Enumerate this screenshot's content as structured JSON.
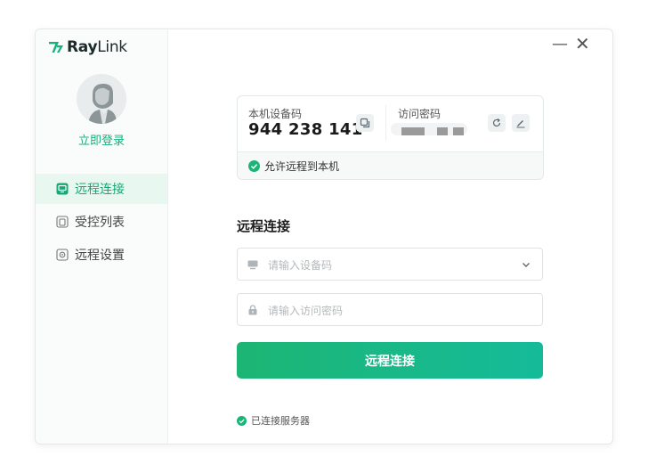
{
  "app": {
    "brand_prefix": "Ray",
    "brand_suffix": "Link"
  },
  "window_controls": {
    "minimize": "—",
    "close": "✕"
  },
  "sidebar": {
    "login_label": "立即登录",
    "items": [
      {
        "label": "远程连接",
        "icon": "monitor-icon",
        "active": true
      },
      {
        "label": "受控列表",
        "icon": "list-icon",
        "active": false
      },
      {
        "label": "远程设置",
        "icon": "settings-icon",
        "active": false
      }
    ]
  },
  "device_card": {
    "code_label": "本机设备码",
    "code_value": "944 238 141",
    "password_label": "访问密码",
    "allow_text": "允许远程到本机"
  },
  "connect_form": {
    "title": "远程连接",
    "device_placeholder": "请输入设备码",
    "password_placeholder": "请输入访问密码",
    "button_label": "远程连接"
  },
  "status": {
    "server_text": "已连接服务器"
  },
  "colors": {
    "accent": "#18a874",
    "accent_light": "#e8f7f0",
    "button_gradient_end": "#15bb99"
  }
}
